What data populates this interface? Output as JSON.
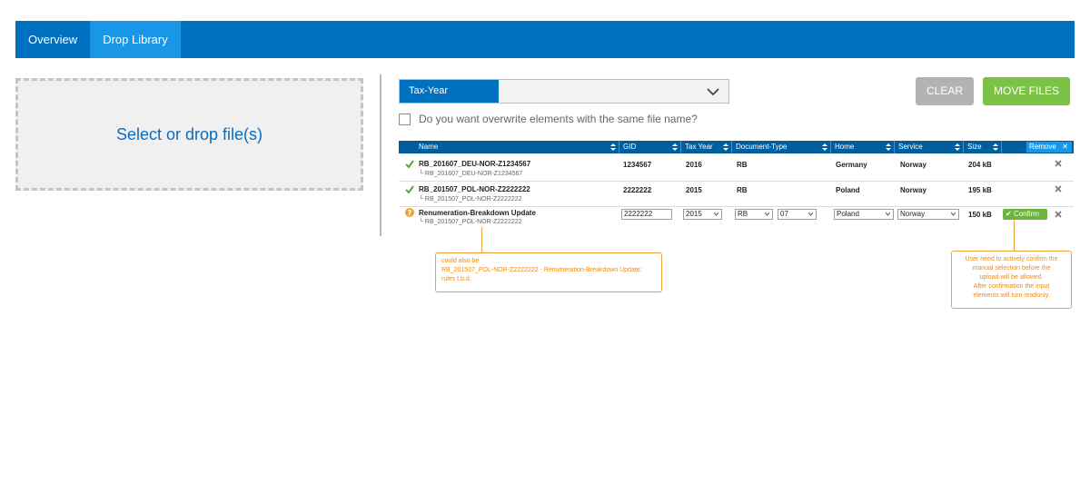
{
  "nav": {
    "tabs": [
      {
        "label": "Overview",
        "active": false
      },
      {
        "label": "Drop Library",
        "active": true
      }
    ]
  },
  "dropzone": {
    "label": "Select or drop file(s)"
  },
  "taxyear": {
    "label": "Tax-Year",
    "value": "",
    "icon": "chevron-down-icon"
  },
  "actions": {
    "clear_label": "CLEAR",
    "move_label": "MOVE FILES"
  },
  "overwrite": {
    "label": "Do you want overwrite elements with the same file name?",
    "checked": false
  },
  "table": {
    "columns": [
      "Name",
      "GID",
      "Tax Year",
      "Document-Type",
      "Home",
      "Service",
      "Size"
    ],
    "remove_label": "Remove",
    "rows": [
      {
        "status": "check-icon",
        "name": "RB_201607_DEU-NOR-Z1234567",
        "sub": "RB_201607_DEU-NOR-Z1234567",
        "gid": "1234567",
        "tax_year": "2016",
        "doc_type": "RB",
        "home": "Germany",
        "service": "Norway",
        "size": "204 kB"
      },
      {
        "status": "check-icon",
        "name": "RB_201507_POL-NOR-Z2222222",
        "sub": "RB_201507_POL-NOR-Z2222222",
        "gid": "2222222",
        "tax_year": "2015",
        "doc_type": "RB",
        "home": "Poland",
        "service": "Norway",
        "size": "195 kB"
      },
      {
        "status": "question-icon",
        "name": "Renumeration-Breakdown Update",
        "sub": "RB_201507_POL-NOR-Z2222222",
        "gid": "2222222",
        "tax_year": "2015",
        "doc_type": "RB",
        "doc_sub": "07",
        "home": "Poland",
        "service": "Norway",
        "size": "150 kB",
        "confirm_label": "Confirm"
      }
    ]
  },
  "notes": {
    "name_note": {
      "line1": "could also be",
      "line2": "RB_201507_POL-NOR-Z2222222 - Renumeration-Breakdown Update;",
      "line3": "rules t.b.d."
    },
    "confirm_note": {
      "line1": "User need to actively confirm the",
      "line2": "manual selection before the",
      "line3": "upload will be allowed.",
      "line4": "After confirmation the input",
      "line5": "elements will turn readonly."
    }
  },
  "colors": {
    "primary": "#0070c0",
    "active_tab": "#1a96e6",
    "move": "#7cc244",
    "clear": "#b3b3b3",
    "note": "#ee8a12"
  }
}
